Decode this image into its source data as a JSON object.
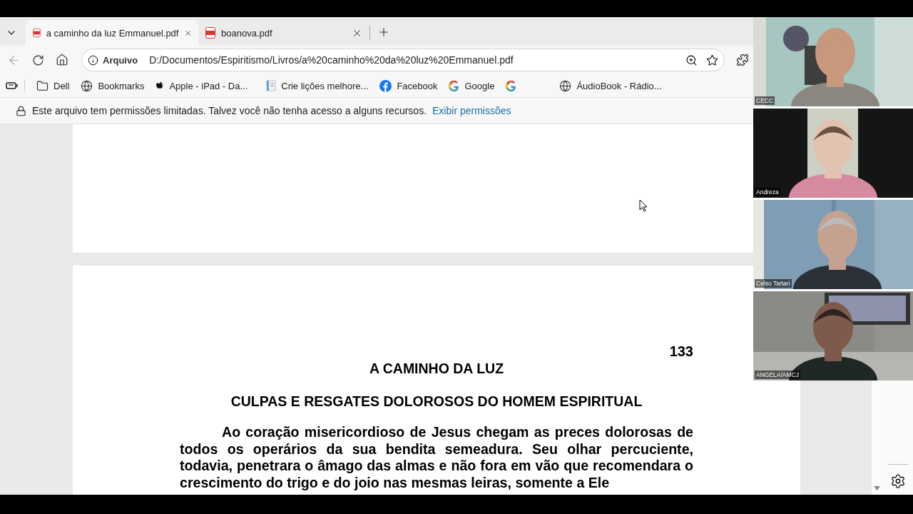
{
  "tabs": [
    {
      "title": "a caminho da luz Emmanuel.pdf",
      "selected": true
    },
    {
      "title": "boanova.pdf",
      "selected": false
    }
  ],
  "address": {
    "scheme": "Arquivo",
    "url": "D:/Documentos/Espiritismo/Livros/a%20caminho%20da%20luz%20Emmanuel.pdf"
  },
  "bookmarks": [
    {
      "kind": "folder",
      "label": "Dell"
    },
    {
      "kind": "globe",
      "label": "Bookmarks"
    },
    {
      "kind": "apple",
      "label": "Apple - iPad - Da..."
    },
    {
      "kind": "doc",
      "label": "Crie lições melhore..."
    },
    {
      "kind": "facebook",
      "label": "Facebook"
    },
    {
      "kind": "google",
      "label": "Google"
    },
    {
      "kind": "google"
    },
    {
      "kind": "globe",
      "label": "ÁudioBook - Rádio..."
    }
  ],
  "info_bar": {
    "message": "Este arquivo tem permissões limitadas. Talvez você não tenha acesso a alguns recursos.",
    "link": "Exibir permissões"
  },
  "document": {
    "page_number": "133",
    "title": "A CAMINHO DA LUZ",
    "chapter": "CULPAS E RESGATES DOLOROSOS DO HOMEM ESPIRITUAL",
    "paragraph": "Ao coração misericordioso de Jesus chegam as preces dolorosas de todos os operários da sua bendita semeadura. Seu olhar percuciente, todavia, penetrara o âmago das almas e não fora em vão que recomendara o crescimento do trigo e do joio nas mesmas leiras, somente a Ele"
  },
  "participants": [
    {
      "name": "CECC",
      "kind": "picture"
    },
    {
      "name": "Andreza",
      "kind": "picture"
    },
    {
      "name": "Celso Tartari",
      "kind": "picture"
    },
    {
      "name": "ANGELA/AMCJ",
      "kind": "picture"
    }
  ]
}
